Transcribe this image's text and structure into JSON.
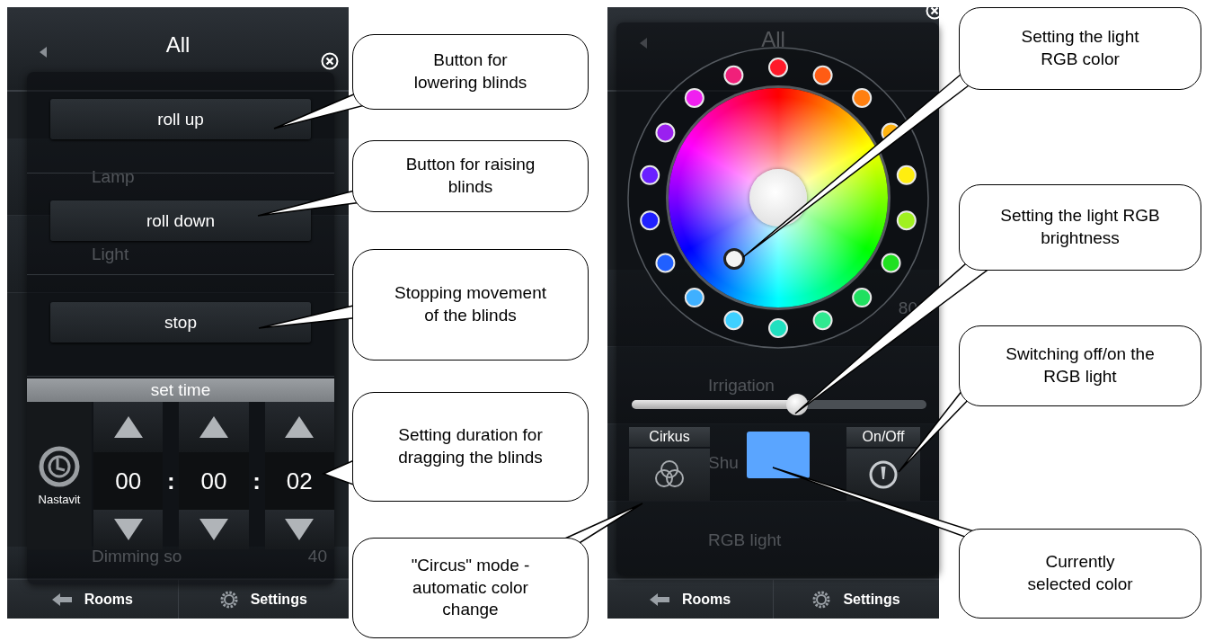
{
  "left_screen": {
    "title": "All",
    "background_rows": [
      {
        "label": "Lamp"
      },
      {
        "label": "Light"
      }
    ],
    "bottom_row": {
      "label": "Dimming so",
      "value": "40"
    },
    "buttons": [
      "roll up",
      "roll down",
      "stop"
    ],
    "timer": {
      "header": "set time",
      "set_label": "Nastavit",
      "values": [
        "00",
        "00",
        "02"
      ],
      "separators": [
        ":",
        ":"
      ]
    },
    "footer": {
      "rooms": "Rooms",
      "settings": "Settings"
    }
  },
  "right_screen": {
    "title": "All",
    "background_rows": [
      {
        "value": "80"
      },
      {
        "label": "Irrigation"
      },
      {
        "label": "Shu"
      },
      {
        "label": "RGB light"
      }
    ],
    "presets": [
      {
        "color": "#ff1a2a"
      },
      {
        "color": "#ff5c14"
      },
      {
        "color": "#ff7f10"
      },
      {
        "color": "#ffb30f"
      },
      {
        "color": "#ffee10"
      },
      {
        "color": "#a0f020"
      },
      {
        "color": "#20e020"
      },
      {
        "color": "#20e060"
      },
      {
        "color": "#30e890"
      },
      {
        "color": "#20e0c0"
      },
      {
        "color": "#3fd0ff"
      },
      {
        "color": "#3fb0ff"
      },
      {
        "color": "#2060ff"
      },
      {
        "color": "#2020ff"
      },
      {
        "color": "#6a20ff"
      },
      {
        "color": "#9a20f0"
      },
      {
        "color": "#f020f0"
      },
      {
        "color": "#f0207a"
      }
    ],
    "brightness": {
      "level": 0.56
    },
    "circus": {
      "label": "Cirkus"
    },
    "current_color": {
      "color": "#5aa5ff"
    },
    "power": {
      "label": "On/Off"
    },
    "footer": {
      "rooms": "Rooms",
      "settings": "Settings"
    }
  },
  "callouts": [
    {
      "text": "Button for lowering blinds"
    },
    {
      "text": "Button for raising blinds"
    },
    {
      "text": "Stopping movement of the blinds"
    },
    {
      "text": "Setting duration for dragging the blinds"
    },
    {
      "text": "\"Circus\" mode - automatic color change"
    },
    {
      "text": "Setting the light RGB color"
    },
    {
      "text": "Setting the light RGB brightness"
    },
    {
      "text": "Switching off/on the RGB light"
    },
    {
      "text": "Currently selected color"
    }
  ]
}
